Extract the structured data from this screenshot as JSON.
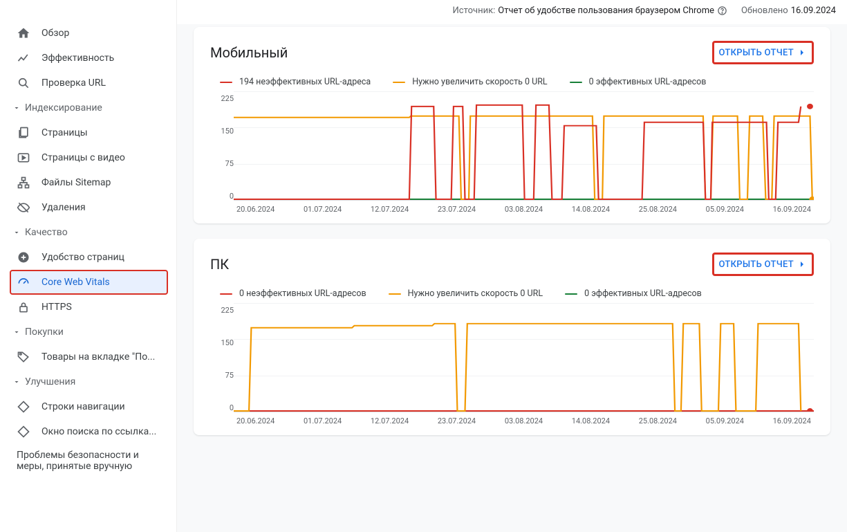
{
  "header": {
    "source_label": "Источник:",
    "source_value": "Отчет об удобстве пользования браузером Chrome",
    "updated_label": "Обновлено",
    "updated_date": "16.09.2024"
  },
  "sidebar": {
    "overview": "Обзор",
    "performance": "Эффективность",
    "url_inspection": "Проверка URL",
    "section_indexing": "Индексирование",
    "pages": "Страницы",
    "video_pages": "Страницы с видео",
    "sitemaps": "Файлы Sitemap",
    "removals": "Удаления",
    "section_quality": "Качество",
    "page_experience": "Удобство страниц",
    "core_web_vitals": "Core Web Vitals",
    "https": "HTTPS",
    "section_shopping": "Покупки",
    "shopping_listings": "Товары на вкладке \"По...",
    "section_enhancements": "Улучшения",
    "breadcrumbs": "Строки навигации",
    "sitelinks": "Окно поиска по ссылка...",
    "security": "Проблемы безопасности и меры, принятые вручную"
  },
  "open_report_label": "ОТКРЫТЬ ОТЧЕТ",
  "mobile_card": {
    "title": "Мобильный",
    "legend": {
      "poor": "194 неэффективных URL-адреса",
      "needs": "Нужно увеличить скорость 0 URL",
      "good": "0 эффективных URL-адресов"
    }
  },
  "pc_card": {
    "title": "ПК",
    "legend": {
      "poor": "0 неэффективных URL-адресов",
      "needs": "Нужно увеличить скорость 0 URL",
      "good": "0 эффективных URL-адресов"
    }
  },
  "y_ticks": {
    "t0": "225",
    "t1": "150",
    "t2": "75",
    "t3": "0"
  },
  "x_ticks": {
    "d0": "20.06.2024",
    "d1": "01.07.2024",
    "d2": "12.07.2024",
    "d3": "23.07.2024",
    "d4": "03.08.2024",
    "d5": "14.08.2024",
    "d6": "25.08.2024",
    "d7": "05.09.2024",
    "d8": "16.09.2024"
  },
  "chart_data": [
    {
      "title": "Мобильный",
      "type": "line",
      "xlabel": "",
      "ylabel": "",
      "ylim": [
        0,
        225
      ],
      "x": [
        "20.06.2024",
        "01.07.2024",
        "12.07.2024",
        "17.07.2024",
        "19.07.2024",
        "21.07.2024",
        "23.07.2024",
        "25.07.2024",
        "27.07.2024",
        "29.07.2024",
        "31.07.2024",
        "03.08.2024",
        "06.08.2024",
        "09.08.2024",
        "12.08.2024",
        "14.08.2024",
        "19.08.2024",
        "25.08.2024",
        "28.08.2024",
        "31.08.2024",
        "03.09.2024",
        "05.09.2024",
        "09.09.2024",
        "12.09.2024",
        "16.09.2024"
      ],
      "series": [
        {
          "name": "Неэффективные URL",
          "color": "#d93025",
          "values": [
            0,
            0,
            0,
            0,
            190,
            0,
            190,
            0,
            195,
            195,
            0,
            195,
            0,
            150,
            0,
            0,
            160,
            160,
            0,
            160,
            160,
            0,
            160,
            160,
            194
          ]
        },
        {
          "name": "Нужно увеличить скорость",
          "color": "#f29900",
          "values": [
            170,
            170,
            170,
            170,
            0,
            170,
            170,
            170,
            170,
            170,
            170,
            170,
            170,
            170,
            170,
            170,
            170,
            170,
            170,
            170,
            0,
            170,
            0,
            170,
            0
          ]
        },
        {
          "name": "Эффективные URL",
          "color": "#188038",
          "values": [
            0,
            0,
            0,
            0,
            0,
            0,
            0,
            0,
            0,
            0,
            0,
            0,
            0,
            0,
            0,
            0,
            0,
            0,
            0,
            0,
            0,
            0,
            0,
            0,
            0
          ]
        }
      ]
    },
    {
      "title": "ПК",
      "type": "line",
      "xlabel": "",
      "ylabel": "",
      "ylim": [
        0,
        225
      ],
      "x": [
        "20.06.2024",
        "22.06.2024",
        "01.07.2024",
        "12.07.2024",
        "23.07.2024",
        "26.07.2024",
        "28.07.2024",
        "03.08.2024",
        "14.08.2024",
        "25.08.2024",
        "27.08.2024",
        "30.08.2024",
        "03.09.2024",
        "05.09.2024",
        "07.09.2024",
        "10.09.2024",
        "12.09.2024",
        "16.09.2024"
      ],
      "series": [
        {
          "name": "Неэффективные URL",
          "color": "#d93025",
          "values": [
            0,
            0,
            0,
            0,
            0,
            0,
            0,
            0,
            0,
            0,
            0,
            0,
            0,
            0,
            0,
            0,
            0,
            0
          ]
        },
        {
          "name": "Нужно увеличить скорость",
          "color": "#f29900",
          "values": [
            0,
            175,
            175,
            180,
            180,
            0,
            180,
            185,
            185,
            185,
            0,
            185,
            0,
            185,
            0,
            185,
            185,
            0
          ]
        },
        {
          "name": "Эффективные URL",
          "color": "#188038",
          "values": [
            0,
            0,
            0,
            0,
            0,
            0,
            0,
            0,
            0,
            0,
            0,
            0,
            0,
            0,
            0,
            0,
            0,
            0
          ]
        }
      ]
    }
  ]
}
